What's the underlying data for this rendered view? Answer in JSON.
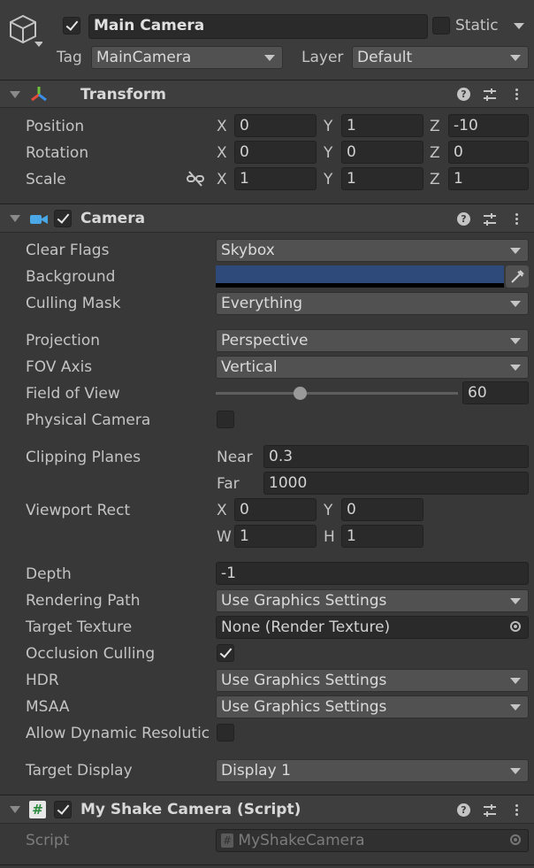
{
  "object": {
    "name": "Main Camera",
    "active": true,
    "static_label": "Static",
    "static": false,
    "tag_label": "Tag",
    "tag_value": "MainCamera",
    "layer_label": "Layer",
    "layer_value": "Default"
  },
  "transform": {
    "title": "Transform",
    "position": {
      "label": "Position",
      "x": "0",
      "y": "1",
      "z": "-10"
    },
    "rotation": {
      "label": "Rotation",
      "x": "0",
      "y": "0",
      "z": "0"
    },
    "scale": {
      "label": "Scale",
      "x": "1",
      "y": "1",
      "z": "1"
    },
    "axis": {
      "x": "X",
      "y": "Y",
      "z": "Z"
    }
  },
  "camera": {
    "title": "Camera",
    "enabled": true,
    "clear_flags": {
      "label": "Clear Flags",
      "value": "Skybox"
    },
    "background": {
      "label": "Background",
      "color": "#2e4a7a"
    },
    "culling_mask": {
      "label": "Culling Mask",
      "value": "Everything"
    },
    "projection": {
      "label": "Projection",
      "value": "Perspective"
    },
    "fov_axis": {
      "label": "FOV Axis",
      "value": "Vertical"
    },
    "field_of_view": {
      "label": "Field of View",
      "value": "60",
      "slider_fraction": 0.35
    },
    "physical_camera": {
      "label": "Physical Camera",
      "checked": false
    },
    "clipping": {
      "label": "Clipping Planes",
      "near_label": "Near",
      "near": "0.3",
      "far_label": "Far",
      "far": "1000"
    },
    "viewport": {
      "label": "Viewport Rect",
      "x_label": "X",
      "x": "0",
      "y_label": "Y",
      "y": "0",
      "w_label": "W",
      "w": "1",
      "h_label": "H",
      "h": "1"
    },
    "depth": {
      "label": "Depth",
      "value": "-1"
    },
    "rendering_path": {
      "label": "Rendering Path",
      "value": "Use Graphics Settings"
    },
    "target_texture": {
      "label": "Target Texture",
      "value": "None (Render Texture)"
    },
    "occlusion_culling": {
      "label": "Occlusion Culling",
      "checked": true
    },
    "hdr": {
      "label": "HDR",
      "value": "Use Graphics Settings"
    },
    "msaa": {
      "label": "MSAA",
      "value": "Use Graphics Settings"
    },
    "dynamic_resolution": {
      "label": "Allow Dynamic Resolutic",
      "checked": false
    },
    "target_display": {
      "label": "Target Display",
      "value": "Display 1"
    }
  },
  "script": {
    "title": "My Shake Camera (Script)",
    "enabled": true,
    "script_label": "Script",
    "script_value": "MyShakeCamera",
    "hash": "#"
  },
  "colors": {
    "accent_blue": "#4aa8e6",
    "background_swatch": "#2e4a7a"
  }
}
